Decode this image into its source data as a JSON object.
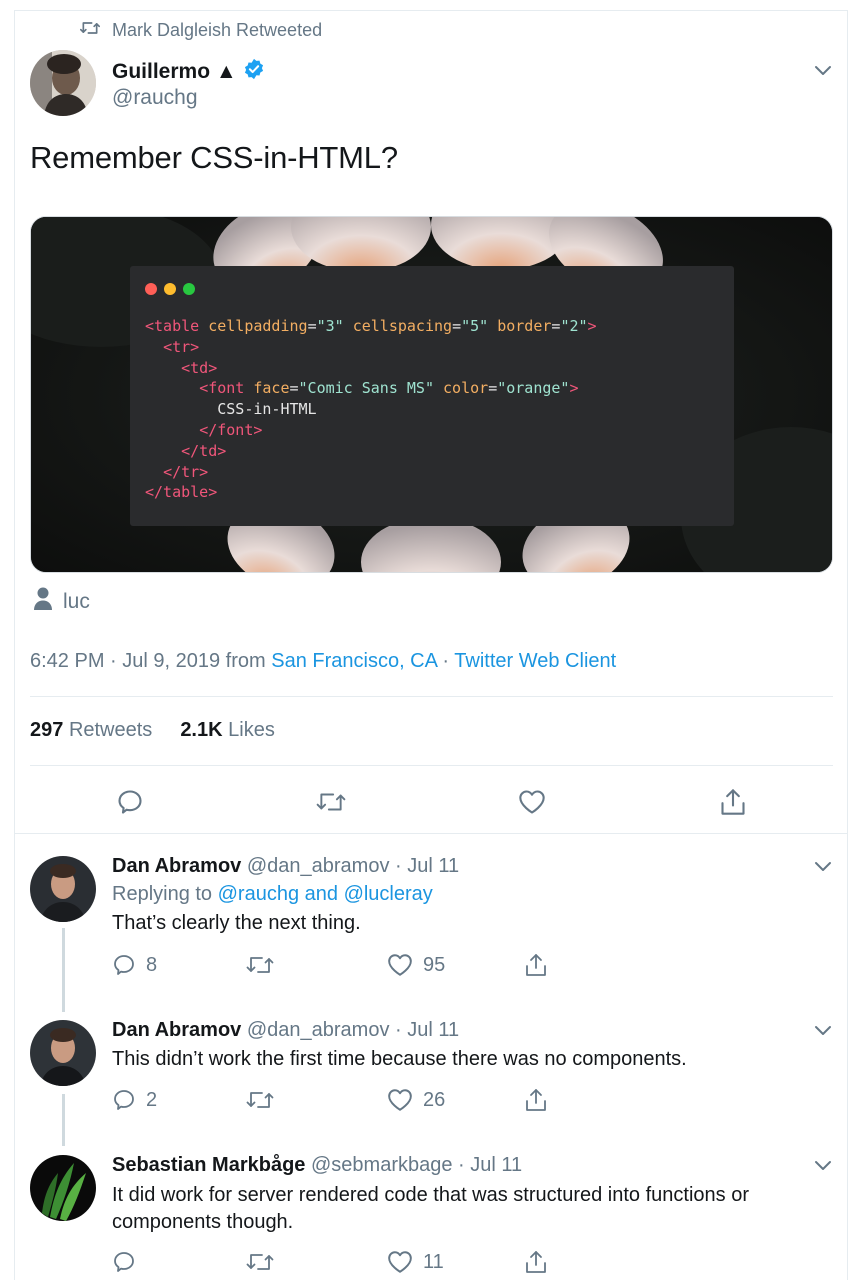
{
  "main_tweet": {
    "retweeted_by": "Mark Dalgleish Retweeted",
    "author_name": "Guillermo ▲",
    "author_handle": "@rauchg",
    "text": "Remember CSS-in-HTML?",
    "tagged_user": "luc",
    "time_date": "6:42 PM · Jul 9, 2019 from ",
    "location": "San Francisco, CA",
    "separator": " · ",
    "client": "Twitter Web Client",
    "retweets_count": "297",
    "retweets_label": "Retweets",
    "likes_count": "2.1K",
    "likes_label": "Likes"
  },
  "code_image": {
    "lines": [
      [
        [
          "tg",
          "<table "
        ],
        [
          "at",
          "cellpadding"
        ],
        [
          "tx",
          "="
        ],
        [
          "sv",
          "\"3\""
        ],
        [
          "tx",
          " "
        ],
        [
          "at",
          "cellspacing"
        ],
        [
          "tx",
          "="
        ],
        [
          "sv",
          "\"5\""
        ],
        [
          "tx",
          " "
        ],
        [
          "at",
          "border"
        ],
        [
          "tx",
          "="
        ],
        [
          "sv",
          "\"2\""
        ],
        [
          "tg",
          ">"
        ]
      ],
      [
        [
          "tx",
          "  "
        ],
        [
          "tg",
          "<tr>"
        ]
      ],
      [
        [
          "tx",
          "    "
        ],
        [
          "tg",
          "<td>"
        ]
      ],
      [
        [
          "tx",
          "      "
        ],
        [
          "tg",
          "<font "
        ],
        [
          "at",
          "face"
        ],
        [
          "tx",
          "="
        ],
        [
          "sv",
          "\"Comic Sans MS\""
        ],
        [
          "tx",
          " "
        ],
        [
          "at",
          "color"
        ],
        [
          "tx",
          "="
        ],
        [
          "sv",
          "\"orange\""
        ],
        [
          "tg",
          ">"
        ]
      ],
      [
        [
          "tx",
          "        CSS-in-HTML"
        ]
      ],
      [
        [
          "tx",
          "      "
        ],
        [
          "tg",
          "</font>"
        ]
      ],
      [
        [
          "tx",
          "    "
        ],
        [
          "tg",
          "</td>"
        ]
      ],
      [
        [
          "tx",
          "  "
        ],
        [
          "tg",
          "</tr>"
        ]
      ],
      [
        [
          "tg",
          "</table>"
        ]
      ]
    ]
  },
  "replies": [
    {
      "name": "Dan Abramov",
      "handle": "@dan_abramov",
      "date": "· Jul 11",
      "replying_prefix": "Replying to ",
      "replying_to": "@rauchg and @lucleray",
      "text": "That’s clearly the next thing.",
      "replies_count": "8",
      "likes_count": "95"
    },
    {
      "name": "Dan Abramov",
      "handle": "@dan_abramov",
      "date": "· Jul 11",
      "text": "This didn’t work the first time because there was no components.",
      "replies_count": "2",
      "likes_count": "26"
    },
    {
      "name": "Sebastian Markbåge",
      "handle": "@sebmarkbage",
      "date": "· Jul 11",
      "text": "It did work for server rendered code that was structured into functions or components though.",
      "replies_count": "",
      "likes_count": "11"
    }
  ],
  "colors": {
    "link": "#1b95e0",
    "muted": "#657786",
    "verified": "#1da1f2",
    "mac_red": "#ff5f57",
    "mac_yellow": "#febc2e",
    "mac_green": "#28c840"
  }
}
